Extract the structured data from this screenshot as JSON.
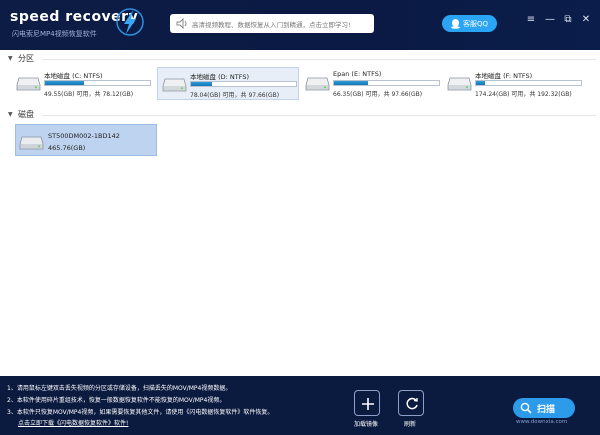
{
  "app": {
    "title": "speed recovery",
    "subtitle": "闪电索尼MP4视频恢复软件"
  },
  "notice": {
    "text": "高清视频教程、数据恢复从入门到精通，点击立即学习!"
  },
  "qq_button": {
    "label": "客服QQ"
  },
  "window_controls": {
    "menu": "≡",
    "minimize": "—",
    "restore": "⧉",
    "close": "✕"
  },
  "sections": {
    "partitions": {
      "label": "分区",
      "arrow": "▼"
    },
    "disks": {
      "label": "磁盘",
      "arrow": "▼"
    }
  },
  "partitions": [
    {
      "name": "本地磁盘 (C: NTFS)",
      "size": "49.55(GB) 可用，共 78.12(GB)",
      "fill": 0.37,
      "selected": false
    },
    {
      "name": "本地磁盘 (D: NTFS)",
      "size": "78.04(GB) 可用，共 97.66(GB)",
      "fill": 0.2,
      "selected": true
    },
    {
      "name": "Epan (E: NTFS)",
      "size": "66.35(GB) 可用，共 97.66(GB)",
      "fill": 0.32,
      "selected": false
    },
    {
      "name": "本地磁盘 (F: NTFS)",
      "size": "174.24(GB) 可用，共 192.32(GB)",
      "fill": 0.09,
      "selected": false
    }
  ],
  "disks": [
    {
      "name": "ST500DM002-1BD142",
      "size": "465.76(GB)"
    }
  ],
  "tips": [
    "1、请用鼠标左键双击丢失视频的分区或存储设备，扫描丢失的MOV/MP4视频数据。",
    "2、本软件使用碎片重组技术，恢复一般数据恢复软件不能恢复的MOV/MP4视频。",
    "3、本软件只恢复MOV/MP4视频，如果需要恢复其他文件，请使用《闪电数据恢复软件》软件恢复。"
  ],
  "download_link": "点击立即下载《闪电数据恢复软件》软件!",
  "footer_buttons": {
    "load_image": "加载镜像",
    "refresh": "刷新"
  },
  "scan_button": {
    "label": "扫描"
  },
  "watermark": "www.downxia.com",
  "colors": {
    "titlebar": "#0b1a3f",
    "accent": "#2aa4f4",
    "bar_fill": "#1e88c9",
    "selected_bg": "#e7eef8"
  }
}
